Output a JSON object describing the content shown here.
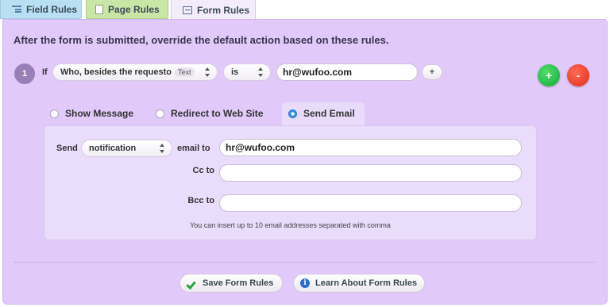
{
  "tabs": [
    {
      "label": "Field Rules",
      "icon": "field-rules-icon"
    },
    {
      "label": "Page Rules",
      "icon": "page-icon"
    },
    {
      "label": "Form Rules",
      "icon": "form-icon"
    }
  ],
  "rules": {
    "heading": "After the form is submitted, override the default action based on these rules.",
    "rule_number": "1",
    "if_label": "If",
    "field_select": "Who, besides the requesto",
    "field_type_badge": "Text",
    "operator_select": "is",
    "condition_value": "hr@wufoo.com",
    "small_add_label": "+",
    "add_rule_label": "+",
    "remove_rule_label": "-"
  },
  "actions": {
    "options": [
      {
        "label": "Show Message",
        "selected": false
      },
      {
        "label": "Redirect to Web Site",
        "selected": false
      },
      {
        "label": "Send Email",
        "selected": true
      }
    ]
  },
  "email": {
    "send_label": "Send",
    "send_type": "notification",
    "email_to_label": "email to",
    "email_to_value": "hr@wufoo.com",
    "cc_label": "Cc to",
    "cc_value": "",
    "bcc_label": "Bcc to",
    "bcc_value": "",
    "hint": "You can insert up to 10 email addresses separated with comma"
  },
  "footer": {
    "save_label": "Save Form Rules",
    "learn_label": "Learn About Form Rules",
    "info_glyph": "i"
  },
  "colors": {
    "panel": "#e1c9f9",
    "email_box": "#eadcfb",
    "add_green": "#15a637",
    "remove_red": "#e02c18",
    "radio_blue": "#2e8ef0"
  }
}
